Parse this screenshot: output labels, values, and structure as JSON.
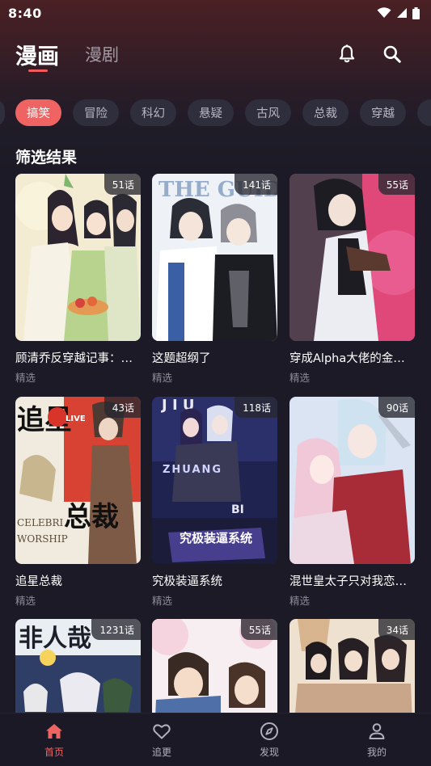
{
  "status_bar": {
    "time": "8:40",
    "icons": [
      "wifi-icon",
      "signal-icon",
      "battery-icon"
    ]
  },
  "header": {
    "tabs": [
      {
        "label": "漫画",
        "active": true
      },
      {
        "label": "漫剧",
        "active": false
      }
    ],
    "icons": [
      "bell-icon",
      "search-icon"
    ],
    "accent_color": "#ef6462"
  },
  "filter_chips": [
    {
      "label": "搞笑",
      "active": true
    },
    {
      "label": "冒险",
      "active": false
    },
    {
      "label": "科幻",
      "active": false
    },
    {
      "label": "悬疑",
      "active": false
    },
    {
      "label": "古风",
      "active": false
    },
    {
      "label": "总裁",
      "active": false
    },
    {
      "label": "穿越",
      "active": false
    }
  ],
  "section": {
    "title": "筛选结果"
  },
  "comics": [
    {
      "title": "顾清乔反穿越记事：古代女子在现代",
      "tag": "精选",
      "episodes": "51话"
    },
    {
      "title": "这题超纲了",
      "tag": "精选",
      "episodes": "141话"
    },
    {
      "title": "穿成Alpha大佬的金丝雀",
      "tag": "精选",
      "episodes": "55话"
    },
    {
      "title": "追星总裁",
      "tag": "精选",
      "episodes": "43话"
    },
    {
      "title": "究极装逼系统",
      "tag": "精选",
      "episodes": "118话"
    },
    {
      "title": "混世皇太子只对我恋爱脑",
      "tag": "精选",
      "episodes": "90话"
    },
    {
      "title": "",
      "tag": "",
      "episodes": "1231话"
    },
    {
      "title": "",
      "tag": "",
      "episodes": "55话"
    },
    {
      "title": "",
      "tag": "",
      "episodes": "34话"
    }
  ],
  "cover_art": {
    "c5_top_text": "J I U",
    "c5_mid_text": "ZHUANG",
    "c5_bi": "BI",
    "c5_logo": "究极装逼系统",
    "c4_logo_top": "追星",
    "c4_logo_bottom": "总裁",
    "c4_live_text": "LIVE",
    "c4_celeb_text": "CELEBRI",
    "c4_worship_text": "WORSHIP",
    "c7_logo": "非人哉",
    "c2_title_art": "THE GUIDE"
  },
  "bottom_nav": [
    {
      "label": "首页",
      "icon": "home-icon",
      "active": true
    },
    {
      "label": "追更",
      "icon": "heart-icon",
      "active": false
    },
    {
      "label": "发现",
      "icon": "compass-icon",
      "active": false
    },
    {
      "label": "我的",
      "icon": "profile-icon",
      "active": false
    }
  ]
}
